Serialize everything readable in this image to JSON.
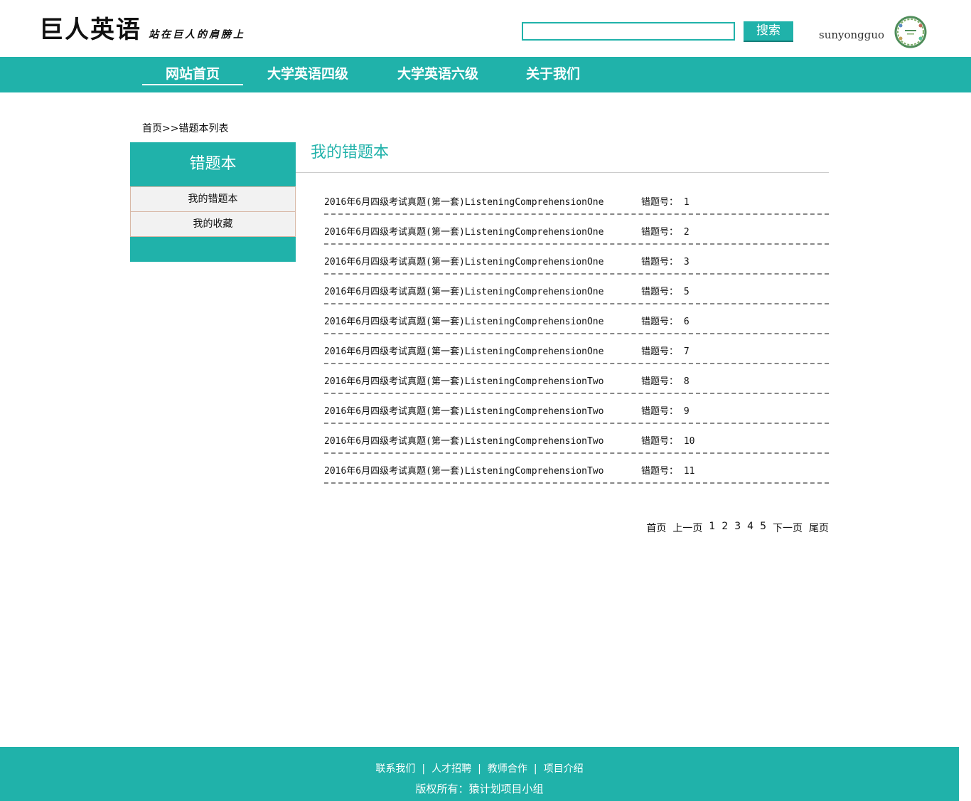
{
  "header": {
    "logo_main": "巨人英语",
    "logo_sub": "站在巨人的肩膀上",
    "search_placeholder": "",
    "search_button": "搜索",
    "username": "sunyongguo"
  },
  "nav": {
    "items": [
      {
        "label": "网站首页",
        "active": true
      },
      {
        "label": "大学英语四级",
        "active": false
      },
      {
        "label": "大学英语六级",
        "active": false
      },
      {
        "label": "关于我们",
        "active": false
      }
    ]
  },
  "breadcrumb": "首页>>错题本列表",
  "sidebar": {
    "title": "错题本",
    "items": [
      "我的错题本",
      "我的收藏"
    ]
  },
  "main": {
    "title": "我的错题本",
    "error_label": "错题号：",
    "rows": [
      {
        "question": "2016年6月四级考试真题(第一套)ListeningComprehensionOne",
        "number": "1"
      },
      {
        "question": "2016年6月四级考试真题(第一套)ListeningComprehensionOne",
        "number": "2"
      },
      {
        "question": "2016年6月四级考试真题(第一套)ListeningComprehensionOne",
        "number": "3"
      },
      {
        "question": "2016年6月四级考试真题(第一套)ListeningComprehensionOne",
        "number": "5"
      },
      {
        "question": "2016年6月四级考试真题(第一套)ListeningComprehensionOne",
        "number": "6"
      },
      {
        "question": "2016年6月四级考试真题(第一套)ListeningComprehensionOne",
        "number": "7"
      },
      {
        "question": "2016年6月四级考试真题(第一套)ListeningComprehensionTwo",
        "number": "8"
      },
      {
        "question": "2016年6月四级考试真题(第一套)ListeningComprehensionTwo",
        "number": "9"
      },
      {
        "question": "2016年6月四级考试真题(第一套)ListeningComprehensionTwo",
        "number": "10"
      },
      {
        "question": "2016年6月四级考试真题(第一套)ListeningComprehensionTwo",
        "number": "11"
      }
    ]
  },
  "pagination": {
    "first": "首页",
    "prev": "上一页",
    "pages": [
      "1",
      "2",
      "3",
      "4",
      "5"
    ],
    "next": "下一页",
    "last": "尾页"
  },
  "footer": {
    "links": [
      "联系我们",
      "人才招聘",
      "教师合作",
      "项目介绍"
    ],
    "separator": "|",
    "copyright": "版权所有：猿计划项目小组"
  },
  "colors": {
    "accent": "#20b2aa",
    "sidebar_item_bg": "#f2f2f2"
  }
}
